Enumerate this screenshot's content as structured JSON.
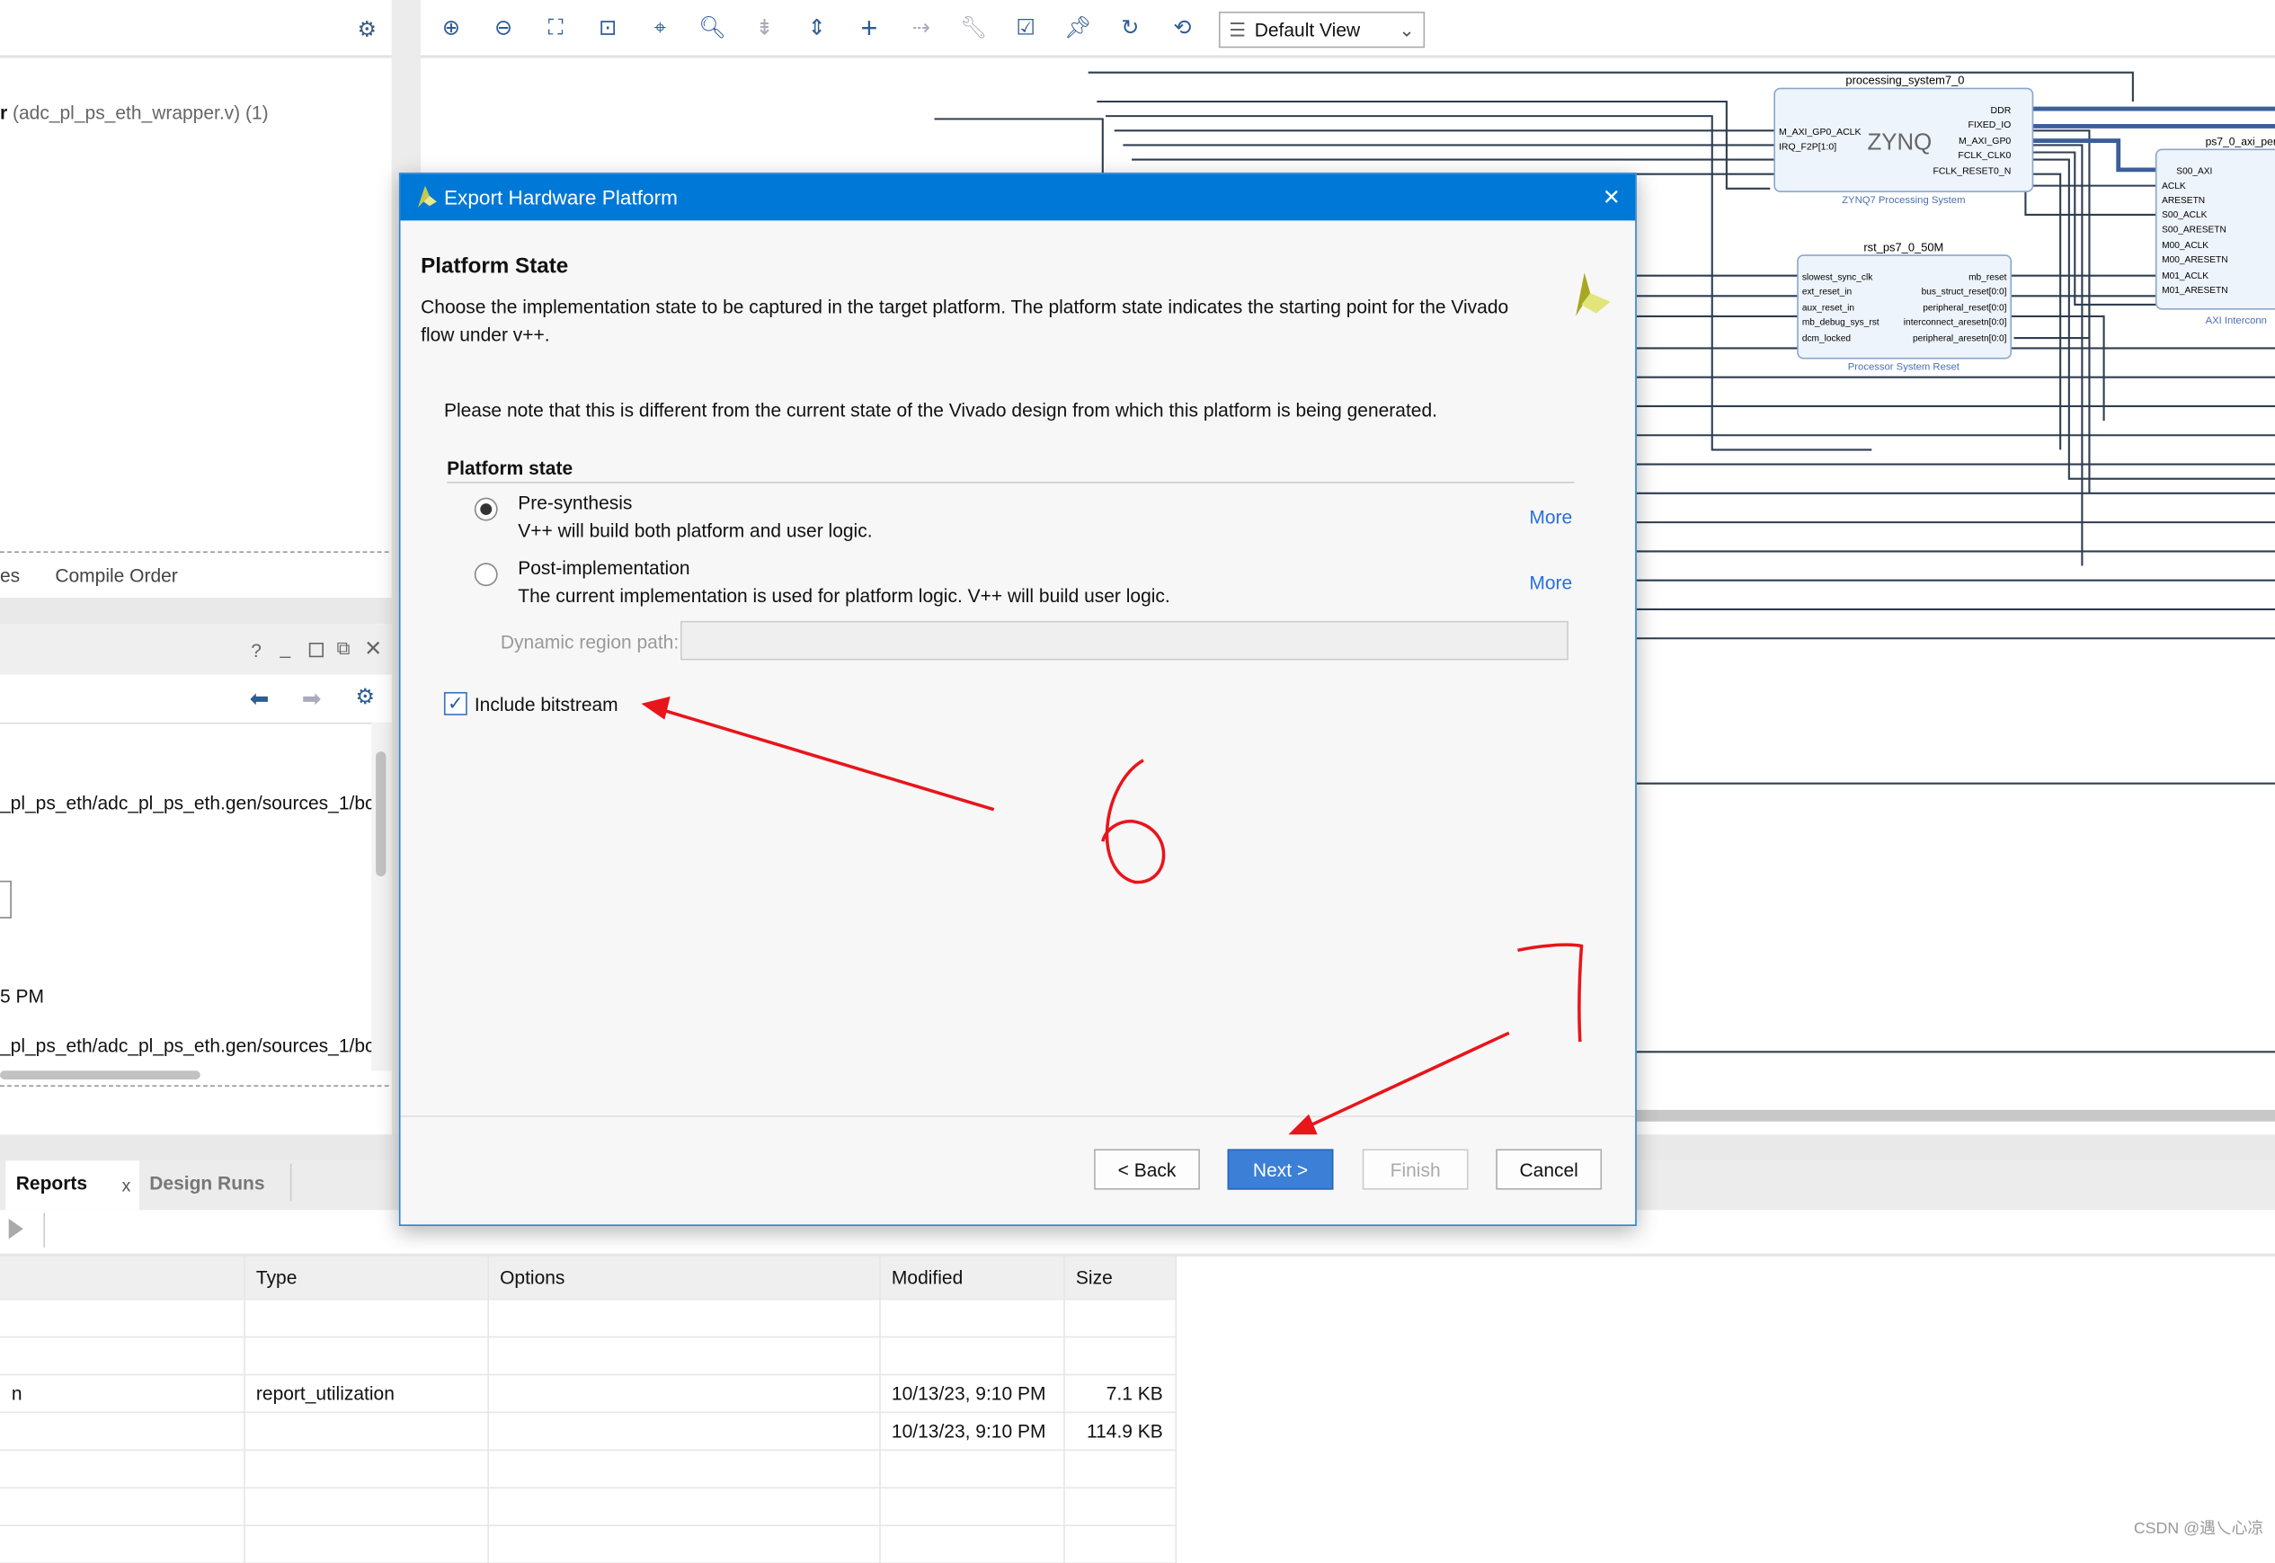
{
  "left_top": {
    "source_text": "r (adc_pl_ps_eth_wrapper.v) (1)",
    "tabs": [
      "es",
      "Compile Order"
    ]
  },
  "left_mid": {
    "paths": [
      "_pl_ps_eth/adc_pl_ps_eth.gen/sources_1/bc",
      "5 PM",
      "_pl_ps_eth/adc_pl_ps_eth.gen/sources_1/bc"
    ],
    "header_icons": [
      "help-icon",
      "minimize-icon",
      "maximize-icon",
      "float-icon",
      "close-icon"
    ]
  },
  "bottom": {
    "tabs": [
      {
        "label": "Reports",
        "active": true
      },
      {
        "label": "Design Runs",
        "active": false
      }
    ],
    "close_glyph": "x",
    "columns": [
      "",
      "Type",
      "Options",
      "Modified",
      "Size"
    ],
    "rows": [
      [
        "",
        "",
        "",
        "",
        ""
      ],
      [
        "",
        "",
        "",
        "",
        ""
      ],
      [
        "n",
        "report_utilization",
        "",
        "10/13/23, 9:10 PM",
        "7.1 KB"
      ],
      [
        "",
        "",
        "",
        "10/13/23, 9:10 PM",
        "114.9 KB"
      ],
      [
        "",
        "",
        "",
        "",
        ""
      ],
      [
        "",
        "",
        "",
        "",
        ""
      ],
      [
        "",
        "",
        "",
        "",
        ""
      ]
    ]
  },
  "diagram_toolbar": {
    "icons": [
      "zoom-in-icon",
      "zoom-out-icon",
      "zoom-fit-icon",
      "zoom-area-icon",
      "center-icon",
      "search-icon",
      "collapse-icon",
      "expand-icon",
      "add-ip-icon",
      "connect-icon",
      "wrench-icon",
      "validate-icon",
      "pin-icon",
      "refresh-icon",
      "regenerate-layout-icon"
    ],
    "view_select": "Default View"
  },
  "diagram": {
    "ps7": {
      "name": "processing_system7_0",
      "subtitle": "ZYNQ7 Processing System",
      "logo": "ZYNQ",
      "inputs": [
        "M_AXI_GP0_ACLK",
        "IRQ_F2P[1:0]"
      ],
      "outputs": [
        "DDR",
        "FIXED_IO",
        "M_AXI_GP0",
        "FCLK_CLK0",
        "FCLK_RESET0_N"
      ]
    },
    "rst": {
      "name": "rst_ps7_0_50M",
      "subtitle": "Processor System Reset",
      "inputs": [
        "slowest_sync_clk",
        "ext_reset_in",
        "aux_reset_in",
        "mb_debug_sys_rst",
        "dcm_locked"
      ],
      "outputs": [
        "mb_reset",
        "bus_struct_reset[0:0]",
        "peripheral_reset[0:0]",
        "interconnect_aresetn[0:0]",
        "peripheral_aresetn[0:0]"
      ]
    },
    "axi": {
      "name": "ps7_0_axi_per",
      "subtitle": "AXI Interconn",
      "inputs": [
        "S00_AXI",
        "ACLK",
        "ARESETN",
        "S00_ACLK",
        "S00_ARESETN",
        "M00_ACLK",
        "M00_ARESETN",
        "M01_ACLK",
        "M01_ARESETN"
      ]
    }
  },
  "dialog": {
    "title": "Export Hardware Platform",
    "heading": "Platform State",
    "description": "Choose the implementation state to be captured in the target platform. The platform state indicates the starting point for the Vivado flow under v++.",
    "note": "Please note that this is different from the current state of the Vivado design from which this platform is being generated.",
    "section": "Platform state",
    "options": [
      {
        "label": "Pre-synthesis",
        "desc": "V++ will build both platform and user logic.",
        "more": "More",
        "selected": true
      },
      {
        "label": "Post-implementation",
        "desc": "The current implementation is used for platform logic. V++ will build user logic.",
        "more": "More",
        "selected": false
      }
    ],
    "dynamic_region_label": "Dynamic region path:",
    "dynamic_region_value": "",
    "include_bitstream": {
      "label": "Include bitstream",
      "checked": true
    },
    "buttons": {
      "back": "< Back",
      "next": "Next >",
      "finish": "Finish",
      "cancel": "Cancel"
    },
    "annotations": [
      "6",
      "7"
    ]
  },
  "watermark": "CSDN @遇乀心凉",
  "colors": {
    "title_bar": "#0078d7",
    "next_button": "#3c7fd6",
    "annotation": "#e8151b",
    "link": "#2a6fdb"
  }
}
